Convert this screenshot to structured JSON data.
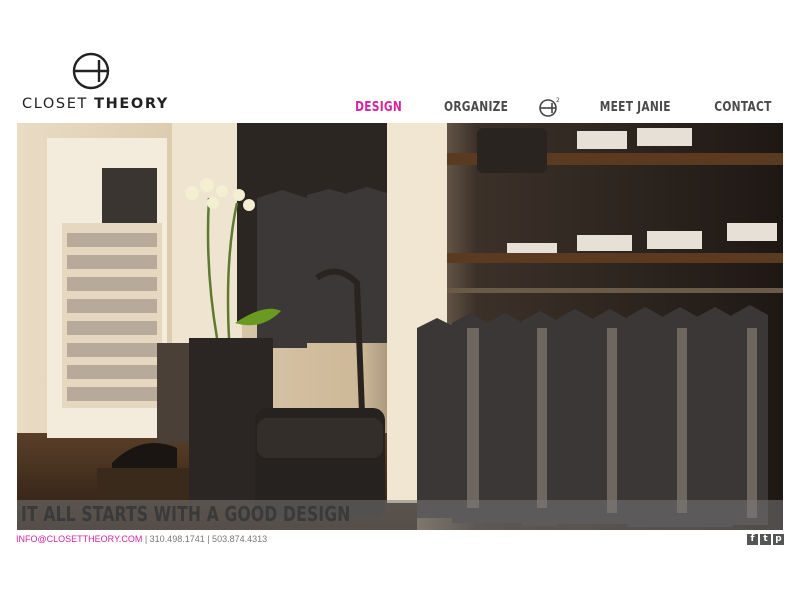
{
  "header": {
    "logo": {
      "word1": "CLOSET",
      "word2": "THEORY"
    },
    "nav": [
      {
        "label": "DESIGN",
        "active": true
      },
      {
        "label": "ORGANIZE",
        "active": false
      },
      {
        "label": "MEET JANIE",
        "active": false
      },
      {
        "label": "CONTACT",
        "active": false
      }
    ]
  },
  "hero": {
    "caption": "IT ALL STARTS WITH A GOOD DESIGN"
  },
  "footer": {
    "email": "INFO@CLOSETTHEORY.COM",
    "phones": " | 310.498.1741 | 503.874.4313"
  },
  "social": [
    {
      "icon": "facebook-icon",
      "glyph": "f"
    },
    {
      "icon": "twitter-icon",
      "glyph": "t"
    },
    {
      "icon": "pinterest-icon",
      "glyph": "p"
    }
  ],
  "colors": {
    "accent": "#d6249f",
    "nav": "#4a4a4a",
    "caption_bar": "#787878"
  }
}
